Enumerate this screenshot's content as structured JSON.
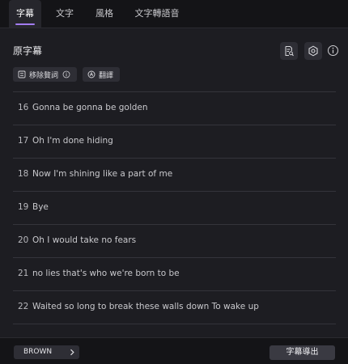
{
  "tabs": [
    {
      "label": "字幕"
    },
    {
      "label": "文字"
    },
    {
      "label": "風格"
    },
    {
      "label": "文字轉語音"
    }
  ],
  "panel": {
    "title": "原字幕",
    "remove_filler_label": "移除贅詞",
    "translate_label": "翻譯"
  },
  "subtitles": [
    {
      "index": "16",
      "text": "Gonna be gonna be golden"
    },
    {
      "index": "17",
      "text": "Oh I'm done hiding"
    },
    {
      "index": "18",
      "text": "Now I'm shining like a part of me"
    },
    {
      "index": "19",
      "text": "Bye"
    },
    {
      "index": "20",
      "text": "Oh I would take no fears"
    },
    {
      "index": "21",
      "text": "no lies that's who we're born to be"
    },
    {
      "index": "22",
      "text": "Waited so long to break these walls down To wake up"
    }
  ],
  "footer": {
    "style_label": "BROWN",
    "export_label": "字幕導出"
  },
  "colors": {
    "accent": "#a27cf0",
    "background": "#1d1d22",
    "tabbar": "#141417"
  }
}
